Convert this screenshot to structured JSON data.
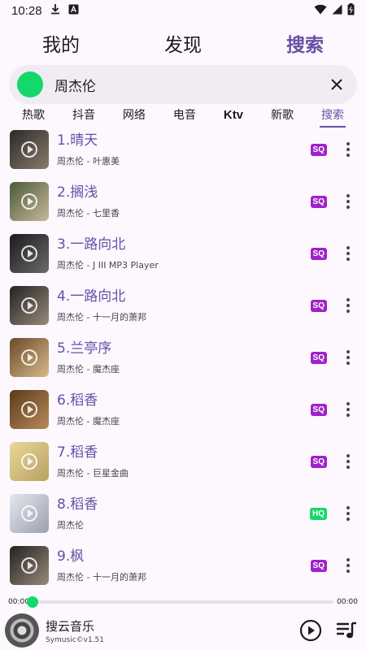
{
  "status": {
    "time": "10:28"
  },
  "top_tabs": [
    {
      "label": "我的",
      "active": false
    },
    {
      "label": "发现",
      "active": false
    },
    {
      "label": "搜索",
      "active": true
    }
  ],
  "search": {
    "value": "周杰伦"
  },
  "categories": [
    "热歌",
    "抖音",
    "网络",
    "电音",
    "Ktv",
    "新歌",
    "搜索"
  ],
  "songs": [
    {
      "title": "1.晴天",
      "subtitle": "周杰伦 - 叶惠美",
      "badge": "SQ",
      "badge_color": "#a023c9",
      "cover": [
        "#2a2a2a",
        "#8a7a6a"
      ]
    },
    {
      "title": "2.搁浅",
      "subtitle": "周杰伦 - 七里香",
      "badge": "SQ",
      "badge_color": "#a023c9",
      "cover": [
        "#4a5a3a",
        "#c9b89a"
      ]
    },
    {
      "title": "3.一路向北",
      "subtitle": "周杰伦 - J III MP3 Player",
      "badge": "SQ",
      "badge_color": "#a023c9",
      "cover": [
        "#1a1a1a",
        "#6a6a6a"
      ]
    },
    {
      "title": "4.一路向北",
      "subtitle": "周杰伦 - 十一月的萧邦",
      "badge": "SQ",
      "badge_color": "#a023c9",
      "cover": [
        "#222222",
        "#9a8a7a"
      ]
    },
    {
      "title": "5.兰亭序",
      "subtitle": "周杰伦 - 魔杰座",
      "badge": "SQ",
      "badge_color": "#a023c9",
      "cover": [
        "#6a4a2a",
        "#d9b98a"
      ]
    },
    {
      "title": "6.稻香",
      "subtitle": "周杰伦 - 魔杰座",
      "badge": "SQ",
      "badge_color": "#a023c9",
      "cover": [
        "#5a3a1a",
        "#b98a5a"
      ]
    },
    {
      "title": "7.稻香",
      "subtitle": "周杰伦 - 巨星金曲",
      "badge": "SQ",
      "badge_color": "#a023c9",
      "cover": [
        "#e8d89a",
        "#b8a060"
      ]
    },
    {
      "title": "8.稻香",
      "subtitle": "周杰伦",
      "badge": "HQ",
      "badge_color": "#13d86a",
      "cover": [
        "#e6e6ee",
        "#9aa0b0"
      ]
    },
    {
      "title": "9.枫",
      "subtitle": "周杰伦 - 十一月的萧邦",
      "badge": "SQ",
      "badge_color": "#a023c9",
      "cover": [
        "#222222",
        "#9a8a7a"
      ]
    }
  ],
  "progress": {
    "current": "00:00",
    "total": "00:00",
    "fraction": 0.0
  },
  "player": {
    "title": "搜云音乐",
    "subtitle": "Symusic©v1.51"
  },
  "colors": {
    "accent": "#6750a4",
    "green": "#13d86a",
    "sq": "#a023c9"
  }
}
